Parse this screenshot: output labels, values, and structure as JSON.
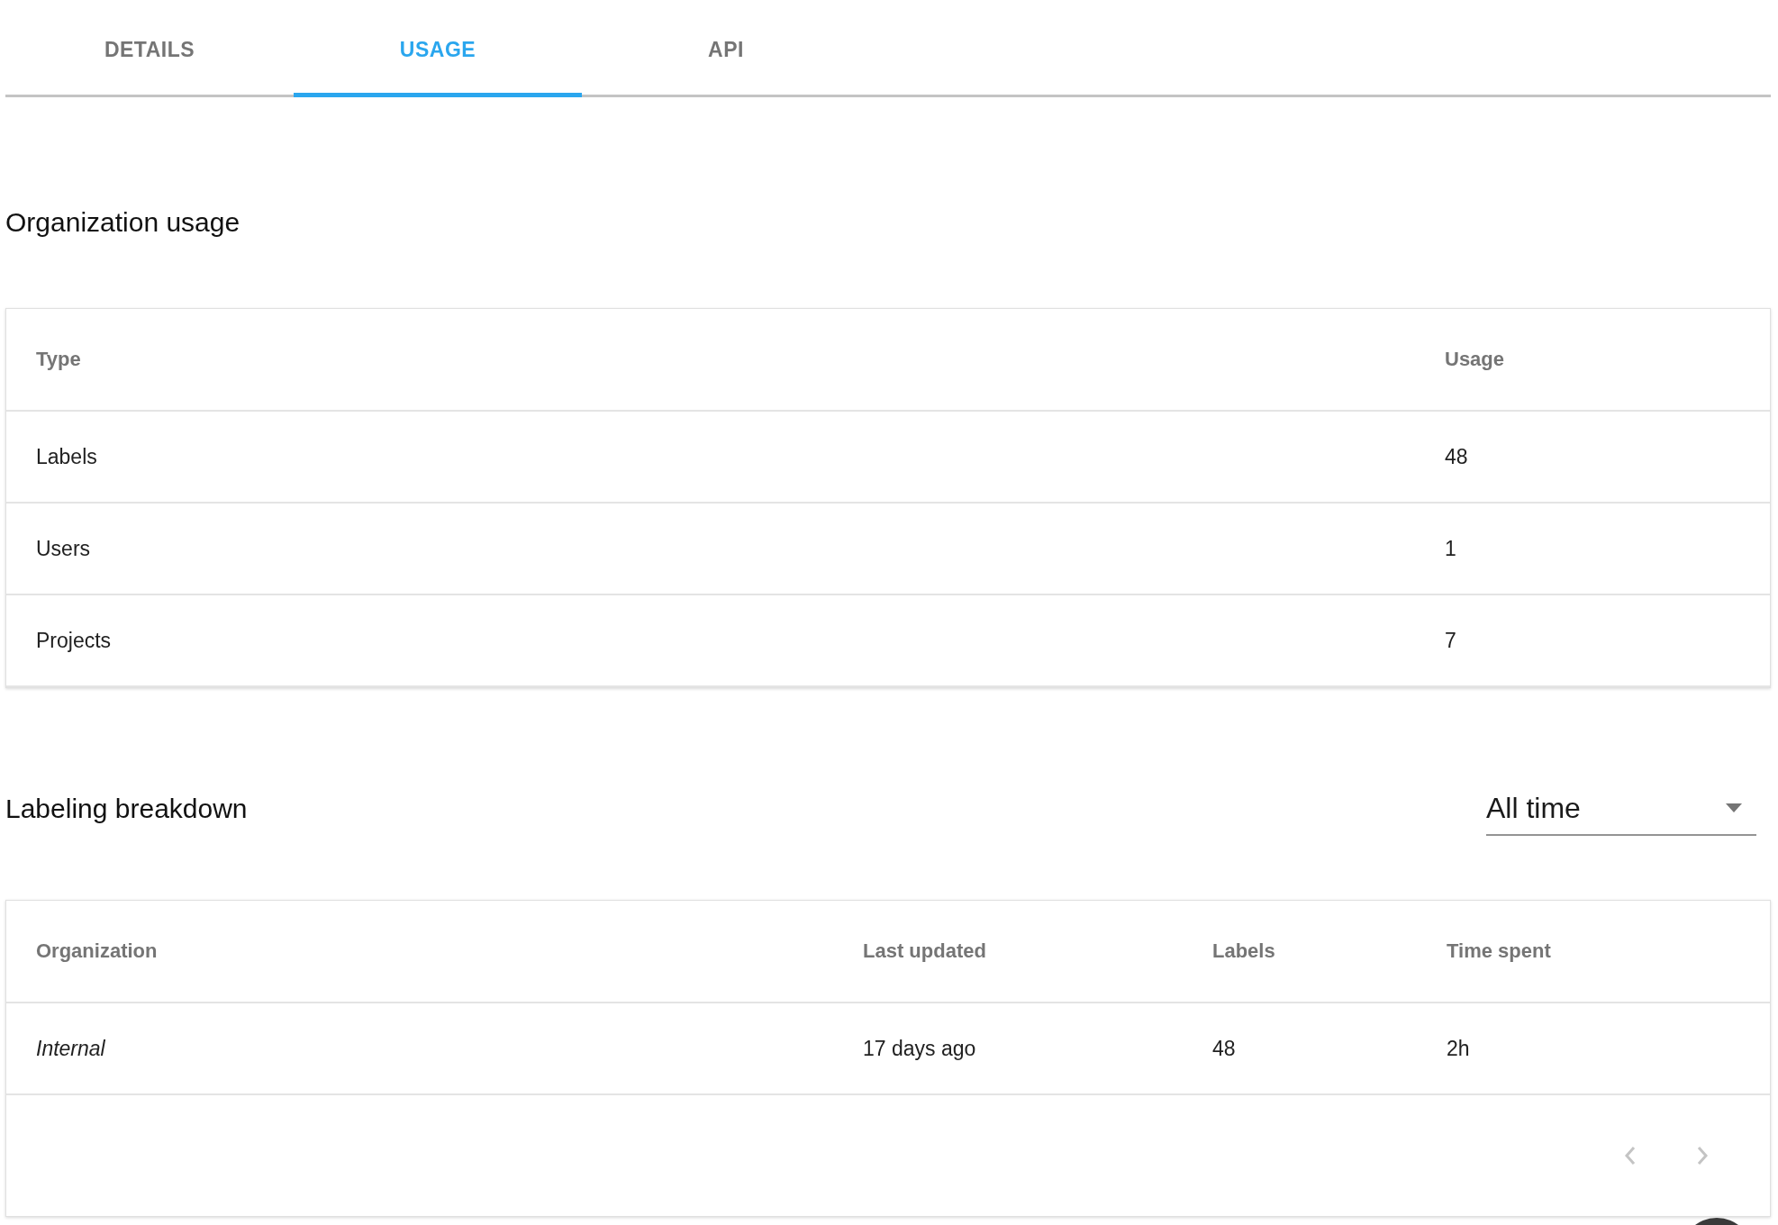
{
  "tabs": [
    {
      "label": "DETAILS",
      "selected": false
    },
    {
      "label": "USAGE",
      "selected": true
    },
    {
      "label": "API",
      "selected": false
    }
  ],
  "organization_usage": {
    "title": "Organization usage",
    "columns": [
      "Type",
      "Usage"
    ],
    "rows": [
      {
        "type": "Labels",
        "usage": "48"
      },
      {
        "type": "Users",
        "usage": "1"
      },
      {
        "type": "Projects",
        "usage": "7"
      }
    ]
  },
  "labeling_breakdown": {
    "title": "Labeling breakdown",
    "period_select": {
      "value": "All time"
    },
    "columns": [
      "Organization",
      "Last updated",
      "Labels",
      "Time spent"
    ],
    "rows": [
      {
        "organization": "Internal",
        "last_updated": "17 days ago",
        "labels": "48",
        "time_spent": "2h"
      }
    ]
  }
}
